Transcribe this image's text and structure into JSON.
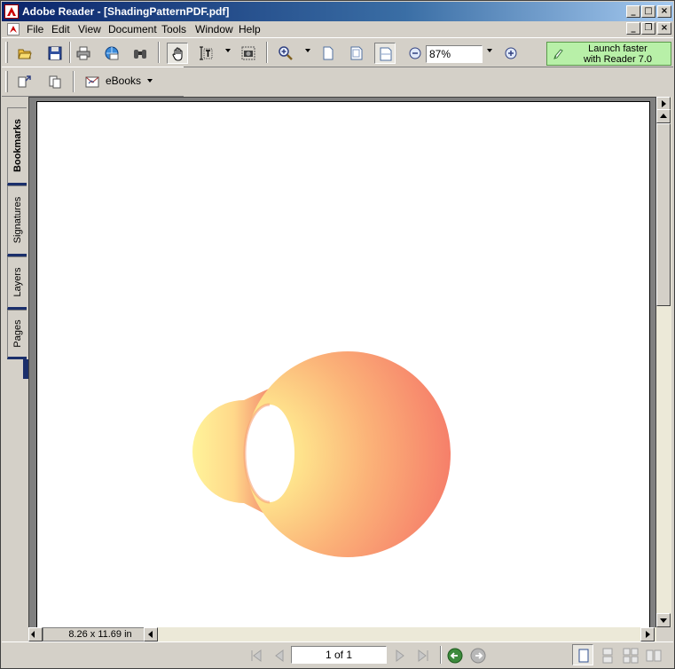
{
  "window": {
    "title": "Adobe Reader - [ShadingPatternPDF.pdf]"
  },
  "menu": {
    "items": [
      "File",
      "Edit",
      "View",
      "Document",
      "Tools",
      "Window",
      "Help"
    ]
  },
  "toolbar": {
    "zoom_value": "87%",
    "ebooks_label": "eBooks",
    "launch_line1": "Launch faster",
    "launch_line2": "with Reader 7.0"
  },
  "side_tabs": [
    "Bookmarks",
    "Signatures",
    "Layers",
    "Pages"
  ],
  "status": {
    "page_size": "8.26 x 11.69 in",
    "page_indicator": "1 of 1"
  },
  "colors": {
    "titlebar_start": "#0a246a",
    "shade_inner": "#fff59a",
    "shade_outer": "#f8866a",
    "launch_bg": "#b8f0a8"
  }
}
